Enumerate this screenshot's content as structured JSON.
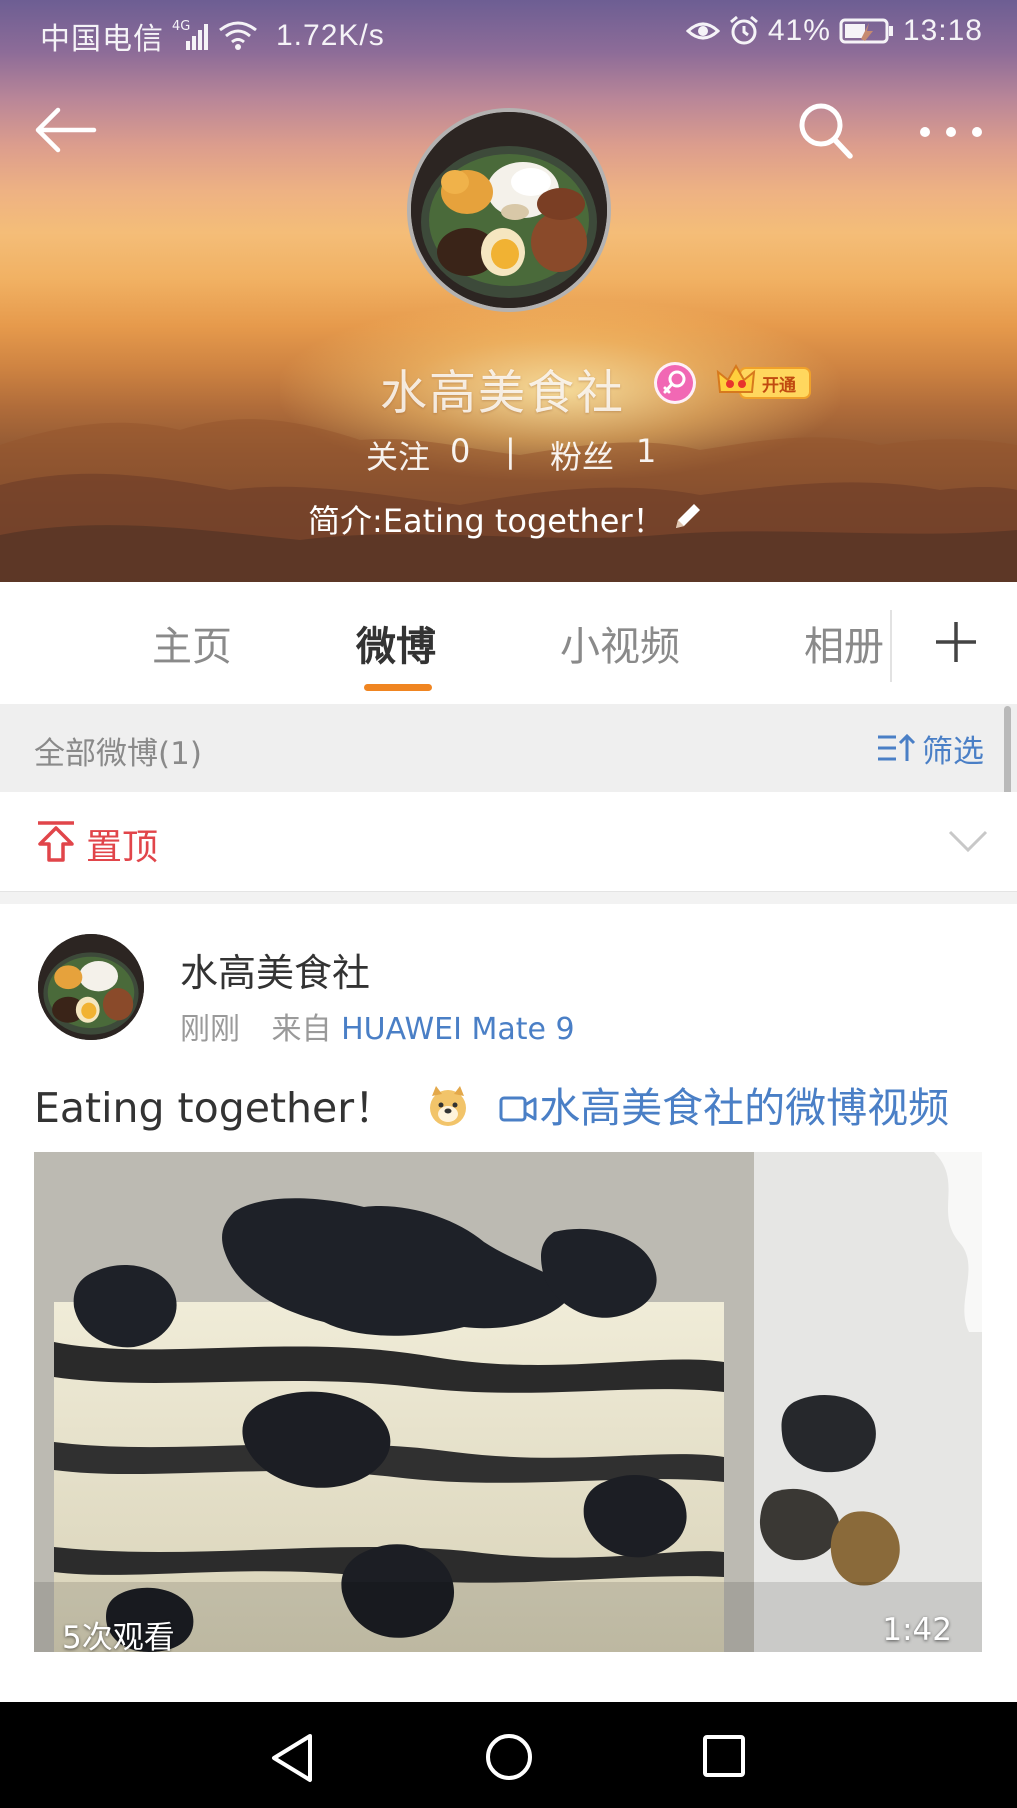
{
  "status_bar": {
    "carrier": "中国电信",
    "network": "4G",
    "speed": "1.72K/s",
    "battery": "41%",
    "time": "13:18"
  },
  "header": {
    "icons": [
      "back-arrow-icon",
      "search-icon",
      "more-icon"
    ]
  },
  "profile": {
    "name": "水高美食社",
    "vip_label": "开通",
    "follow_label": "关注",
    "follow_count": "0",
    "separator": "|",
    "fans_label": "粉丝",
    "fans_count": "1",
    "bio": "简介:Eating together！"
  },
  "tabs": [
    {
      "label": "主页"
    },
    {
      "label": "微博"
    },
    {
      "label": "小视频"
    },
    {
      "label": "相册"
    }
  ],
  "filter_bar": {
    "title": "全部微博(1)",
    "filter_label": "筛选"
  },
  "pinned": {
    "label": "置顶"
  },
  "post": {
    "author": "水高美食社",
    "time": "刚刚",
    "from_label": "来自",
    "source": "HUAWEI Mate 9",
    "text": "Eating together！",
    "video_link": "水高美食社的微博视频",
    "view_count": "5次观看",
    "duration": "1:42"
  },
  "colors": {
    "accent_orange": "#f08521",
    "link_blue": "#4a7fc6",
    "pinned_red": "#e1454a"
  }
}
